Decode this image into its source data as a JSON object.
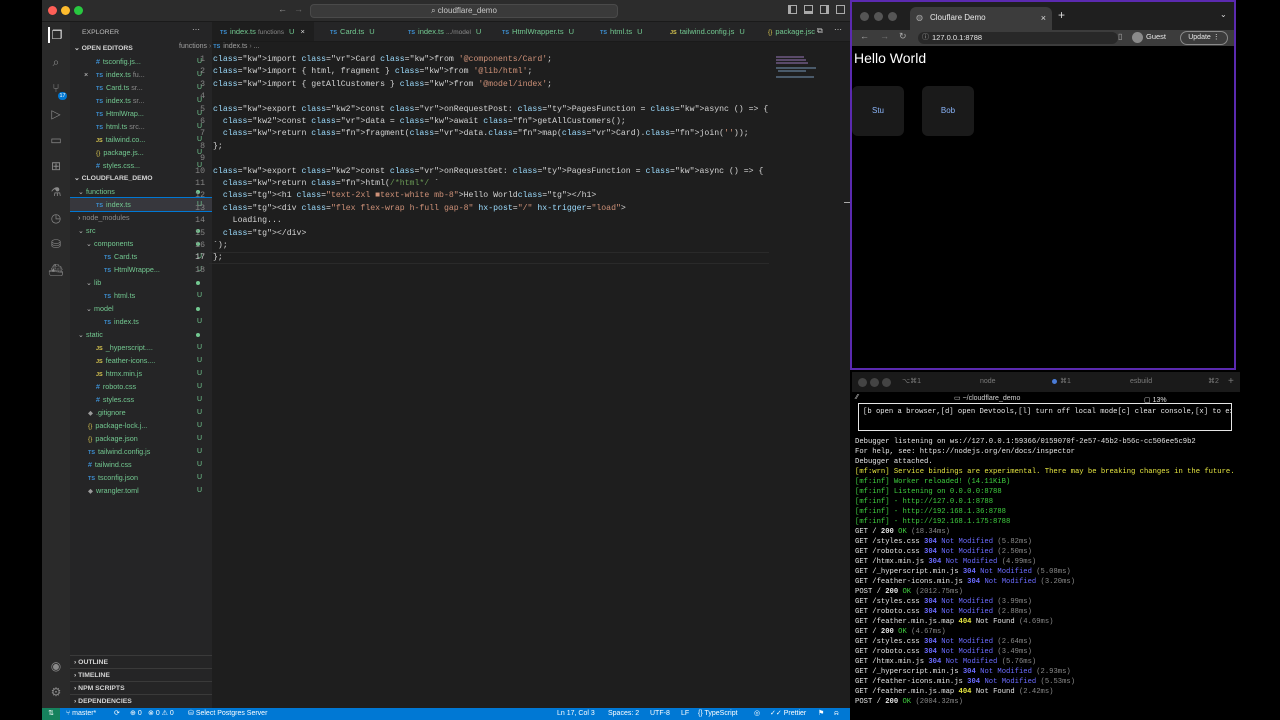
{
  "vscode": {
    "command_center": "cloudflare_demo",
    "explorer": {
      "title": "EXPLORER",
      "open_editors_label": "OPEN EDITORS",
      "open_editors": [
        {
          "icon": "css",
          "name": "tsconfig.js...",
          "status": "U"
        },
        {
          "icon": "ts",
          "name": "index.ts",
          "hint": "fu...",
          "status": "U",
          "close": "×"
        },
        {
          "icon": "ts",
          "name": "Card.ts",
          "hint": "sr...",
          "status": "U"
        },
        {
          "icon": "ts",
          "name": "index.ts",
          "hint": "sr...",
          "status": "U"
        },
        {
          "icon": "ts",
          "name": "HtmlWrap...",
          "status": "U"
        },
        {
          "icon": "ts",
          "name": "html.ts",
          "hint": "src...",
          "status": "U"
        },
        {
          "icon": "js",
          "name": "tailwind.co...",
          "status": "U"
        },
        {
          "icon": "json",
          "name": "package.js...",
          "status": "U"
        },
        {
          "icon": "css",
          "name": "styles.css...",
          "status": "U"
        }
      ],
      "project_label": "CLOUDFLARE_DEMO",
      "tree": [
        {
          "type": "folder",
          "name": "functions",
          "depth": 0,
          "open": true,
          "dot": true
        },
        {
          "type": "ts",
          "name": "index.ts",
          "depth": 1,
          "status": "U",
          "selected": true
        },
        {
          "type": "folder",
          "name": "node_modules",
          "depth": 0,
          "open": false,
          "dim": true
        },
        {
          "type": "folder",
          "name": "src",
          "depth": 0,
          "open": true,
          "dot": true
        },
        {
          "type": "folder",
          "name": "components",
          "depth": 1,
          "open": true,
          "dot": true
        },
        {
          "type": "ts",
          "name": "Card.ts",
          "depth": 2,
          "status": "U"
        },
        {
          "type": "ts",
          "name": "HtmlWrappe...",
          "depth": 2,
          "status": "U"
        },
        {
          "type": "folder",
          "name": "lib",
          "depth": 1,
          "open": true,
          "dot": true
        },
        {
          "type": "ts",
          "name": "html.ts",
          "depth": 2,
          "status": "U"
        },
        {
          "type": "folder",
          "name": "model",
          "depth": 1,
          "open": true,
          "dot": true
        },
        {
          "type": "ts",
          "name": "index.ts",
          "depth": 2,
          "status": "U"
        },
        {
          "type": "folder",
          "name": "static",
          "depth": 0,
          "open": true,
          "dot": true
        },
        {
          "type": "js",
          "name": "_hyperscript....",
          "depth": 1,
          "status": "U"
        },
        {
          "type": "js",
          "name": "feather-icons....",
          "depth": 1,
          "status": "U"
        },
        {
          "type": "js",
          "name": "htmx.min.js",
          "depth": 1,
          "status": "U"
        },
        {
          "type": "css",
          "name": "roboto.css",
          "depth": 1,
          "status": "U"
        },
        {
          "type": "css",
          "name": "styles.css",
          "depth": 1,
          "status": "U"
        },
        {
          "type": "other",
          "name": ".gitignore",
          "depth": 0,
          "status": "U"
        },
        {
          "type": "json",
          "name": "package-lock.j...",
          "depth": 0,
          "status": "U"
        },
        {
          "type": "json",
          "name": "package.json",
          "depth": 0,
          "status": "U"
        },
        {
          "type": "ts",
          "name": "tailwind.config.js",
          "depth": 0,
          "status": "U"
        },
        {
          "type": "css",
          "name": "tailwind.css",
          "depth": 0,
          "status": "U"
        },
        {
          "type": "ts",
          "name": "tsconfig.json",
          "depth": 0,
          "status": "U"
        },
        {
          "type": "other",
          "name": "wrangler.toml",
          "depth": 0,
          "status": "U"
        }
      ],
      "bottom_sections": [
        "OUTLINE",
        "TIMELINE",
        "NPM SCRIPTS",
        "DEPENDENCIES"
      ]
    },
    "tabs": [
      {
        "icon": "TS",
        "name": "index.ts",
        "hint": "functions",
        "status": "U",
        "active": true
      },
      {
        "icon": "TS",
        "name": "Card.ts",
        "hint": "",
        "status": "U"
      },
      {
        "icon": "TS",
        "name": "index.ts",
        "hint": ".../model",
        "status": "U"
      },
      {
        "icon": "TS",
        "name": "HtmlWrapper.ts",
        "hint": "",
        "status": "U"
      },
      {
        "icon": "TS",
        "name": "html.ts",
        "hint": "",
        "status": "U"
      },
      {
        "icon": "JS",
        "name": "tailwind.config.js",
        "hint": "",
        "status": "U"
      },
      {
        "icon": "{}",
        "name": "package.jsc",
        "hint": "",
        "status": ""
      }
    ],
    "breadcrumb": {
      "folder": "functions",
      "file": "index.ts",
      "rest": "..."
    },
    "code": [
      "import Card from '@components/Card';",
      "import { html, fragment } from '@lib/html';",
      "import { getAllCustomers } from '@model/index';",
      "",
      "export const onRequestPost: PagesFunction = async () => {",
      "  const data = await getAllCustomers();",
      "  return fragment(data.map(Card).join(''));",
      "};",
      "",
      "export const onRequestGet: PagesFunction = async () => {",
      "  return html(/*html*/ `",
      "  <h1 class=\"text-2xl ■text-white mb-8\">Hello World</h1>",
      "  <div class=\"flex flex-wrap h-full gap-8\" hx-post=\"/\" hx-trigger=\"load\">",
      "    Loading...",
      "  </div>",
      "`);",
      "};",
      ""
    ],
    "line_numbers": [
      "1",
      "2",
      "3",
      "4",
      "5",
      "6",
      "7",
      "8",
      "9",
      "10",
      "11",
      "12",
      "13",
      "14",
      "15",
      "16",
      "17",
      "18"
    ],
    "current_line": 17,
    "status": {
      "branch": "master*",
      "errors": "0",
      "warnings": "0",
      "ports": "0",
      "db": "Select Postgres Server",
      "position": "Ln 17, Col 3",
      "spaces": "Spaces: 2",
      "encoding": "UTF-8",
      "eol": "LF",
      "language": "TypeScript",
      "formatter": "Prettier"
    }
  },
  "browser": {
    "tab_title": "Clouflare Demo",
    "url": "127.0.0.1:8788",
    "profile": "Guest",
    "update_label": "Update",
    "heading": "Hello World",
    "cards": [
      "Stu",
      "Bob"
    ]
  },
  "terminal": {
    "tabs": [
      {
        "label": "⌥⌘1",
        "title": "node"
      },
      {
        "label": "⌘1",
        "title": ""
      },
      {
        "label": "",
        "title": "esbuild"
      },
      {
        "label": "⌘2",
        "title": ""
      }
    ],
    "path": "~/cloudflare_demo",
    "prompt_marker": "⁄⁄",
    "hint_box": "[b open a browser,[d] open Devtools,[l] turn off local mode[c] clear console,[x] to exit",
    "lines": [
      {
        "t": "Debugger listening on ws://127.0.0.1:59366/0159070f-2e57-45b2-b56c-cc506ee5c9b2",
        "c": ""
      },
      {
        "t": "For help, see: https://nodejs.org/en/docs/inspector",
        "c": ""
      },
      {
        "t": "Debugger attached.",
        "c": ""
      },
      {
        "t": "[mf:wrn] Service bindings are experimental. There may be breaking changes in the future.",
        "c": "y"
      },
      {
        "t": "[mf:inf] Worker reloaded! (14.11KiB)",
        "c": "g"
      },
      {
        "t": "[mf:inf] Listening on 0.0.0.0:8788",
        "c": "g"
      },
      {
        "t": "[mf:inf] - http://127.0.0.1:8788",
        "c": "g"
      },
      {
        "t": "[mf:inf] - http://192.168.1.36:8788",
        "c": "g"
      },
      {
        "t": "[mf:inf] - http://192.168.1.175:8788",
        "c": "g"
      },
      {
        "t": "GET / 200 OK (18.34ms)",
        "c": "req"
      },
      {
        "t": "GET /styles.css 304 Not Modified (5.82ms)",
        "c": "req"
      },
      {
        "t": "GET /roboto.css 304 Not Modified (2.50ms)",
        "c": "req"
      },
      {
        "t": "GET /htmx.min.js 304 Not Modified (4.99ms)",
        "c": "req"
      },
      {
        "t": "GET /_hyperscript.min.js 304 Not Modified (5.08ms)",
        "c": "req"
      },
      {
        "t": "GET /feather-icons.min.js 304 Not Modified (3.20ms)",
        "c": "req"
      },
      {
        "t": "POST / 200 OK (2012.75ms)",
        "c": "req"
      },
      {
        "t": "GET /styles.css 304 Not Modified (3.99ms)",
        "c": "req"
      },
      {
        "t": "GET /roboto.css 304 Not Modified (2.88ms)",
        "c": "req"
      },
      {
        "t": "GET /feather.min.js.map 404 Not Found (4.69ms)",
        "c": "req"
      },
      {
        "t": "GET / 200 OK (4.67ms)",
        "c": "req"
      },
      {
        "t": "GET /styles.css 304 Not Modified (2.64ms)",
        "c": "req"
      },
      {
        "t": "GET /roboto.css 304 Not Modified (3.49ms)",
        "c": "req"
      },
      {
        "t": "GET /htmx.min.js 304 Not Modified (5.76ms)",
        "c": "req"
      },
      {
        "t": "GET /_hyperscript.min.js 304 Not Modified (2.93ms)",
        "c": "req"
      },
      {
        "t": "GET /feather-icons.min.js 304 Not Modified (5.53ms)",
        "c": "req"
      },
      {
        "t": "GET /feather.min.js.map 404 Not Found (2.42ms)",
        "c": "req"
      },
      {
        "t": "POST / 200 OK (2004.32ms)",
        "c": "req"
      }
    ]
  },
  "menubar": {
    "battery": "13%"
  },
  "colors": {
    "accent": "#0078d4",
    "git_untracked": "#73c991",
    "terminal_green": "#3fcf3f",
    "terminal_blue": "#6b6bff",
    "browser_border": "#5b2ab0"
  }
}
